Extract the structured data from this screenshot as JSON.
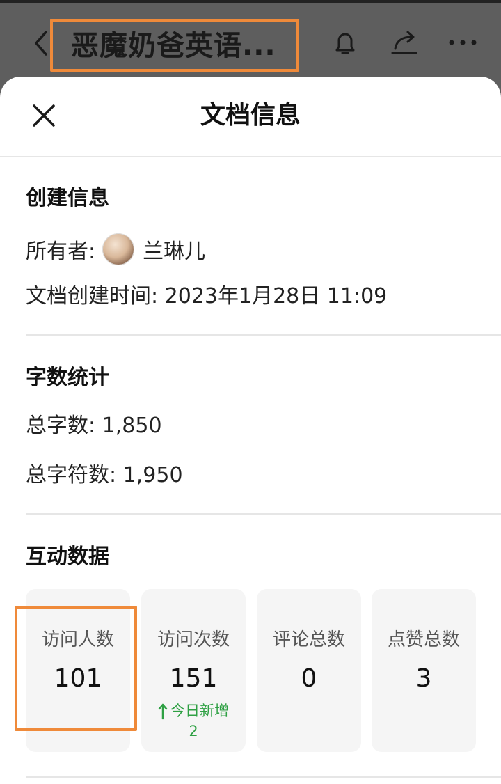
{
  "app_bar": {
    "doc_title": "恶魔奶爸英语...",
    "highlight_color": "#ef8a3a",
    "icons": [
      "back-icon",
      "bell-icon",
      "share-icon",
      "more-icon"
    ]
  },
  "sheet": {
    "title": "文档信息",
    "close_icon": "close-icon"
  },
  "creation": {
    "section_title": "创建信息",
    "owner_label": "所有者:",
    "owner_name": "兰琳儿",
    "created_label": "文档创建时间:",
    "created_value": "2023年1月28日 11:09"
  },
  "word_stats": {
    "section_title": "字数统计",
    "total_words_label": "总字数:",
    "total_words_value": "1,850",
    "total_chars_label": "总字符数:",
    "total_chars_value": "1,950"
  },
  "interaction": {
    "section_title": "互动数据",
    "cards": [
      {
        "label": "访问人数",
        "value": "101"
      },
      {
        "label": "访问次数",
        "value": "151",
        "delta_label": "今日新增",
        "delta_value": "2"
      },
      {
        "label": "评论总数",
        "value": "0"
      },
      {
        "label": "点赞总数",
        "value": "3"
      }
    ],
    "delta_color": "#2ea043"
  }
}
